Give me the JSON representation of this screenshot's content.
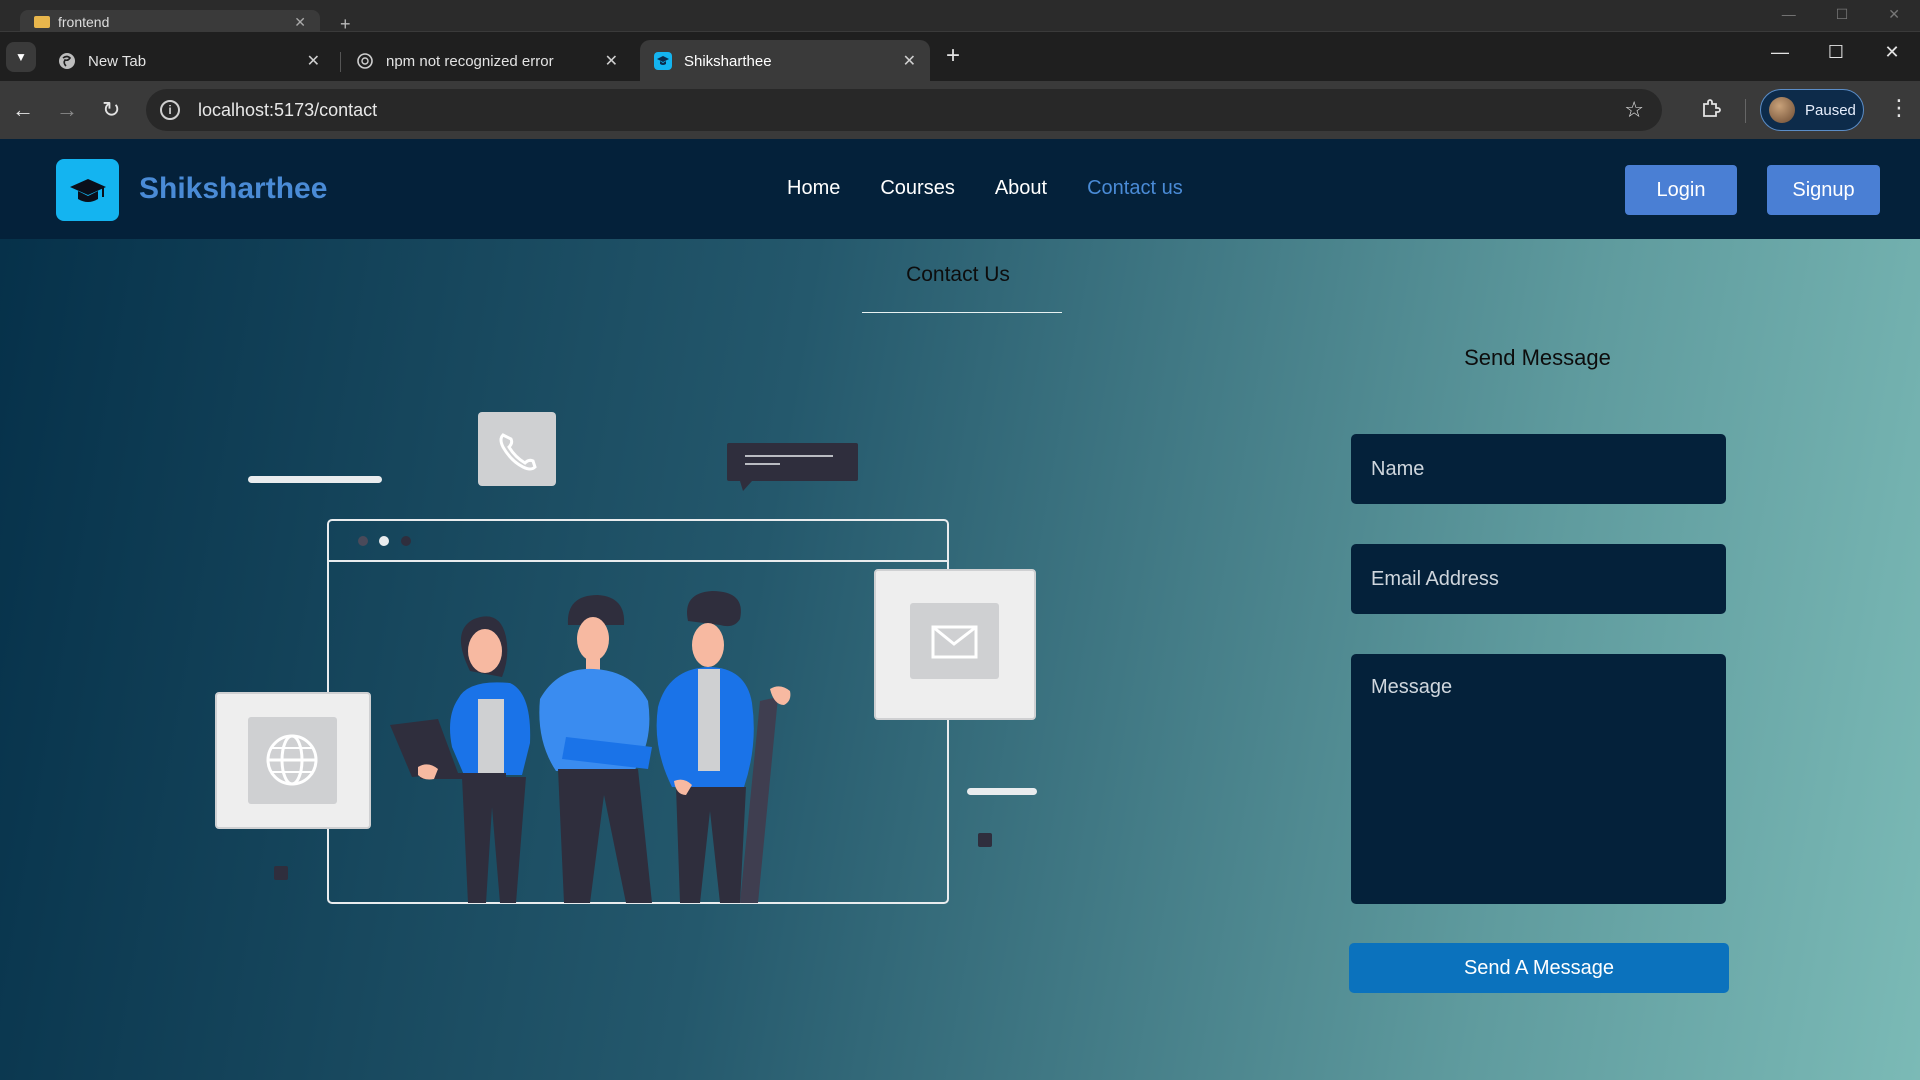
{
  "browser": {
    "background_window": {
      "tab_label": "frontend"
    },
    "tabs": [
      {
        "label": "New Tab",
        "icon": "globe-icon"
      },
      {
        "label": "npm not recognized error",
        "icon": "openai-icon"
      },
      {
        "label": "Shiksharthee",
        "icon": "graduation-cap-icon",
        "active": true
      }
    ],
    "address_bar": {
      "url": "localhost:5173/contact"
    },
    "profile": {
      "label": "Paused"
    }
  },
  "site": {
    "brand": "Shiksharthee",
    "nav": [
      "Home",
      "Courses",
      "About",
      "Contact us"
    ],
    "active_nav": "Contact us",
    "login_label": "Login",
    "signup_label": "Signup"
  },
  "contact": {
    "title": "Contact Us",
    "form_title": "Send Message",
    "name_placeholder": "Name",
    "email_placeholder": "Email Address",
    "message_placeholder": "Message",
    "submit_label": "Send A Message"
  },
  "colors": {
    "nav_bg": "#04213a",
    "brand": "#4a8bd6",
    "button": "#4a7fd4",
    "submit": "#0b72bd",
    "logo_bg": "#14b4f0"
  }
}
